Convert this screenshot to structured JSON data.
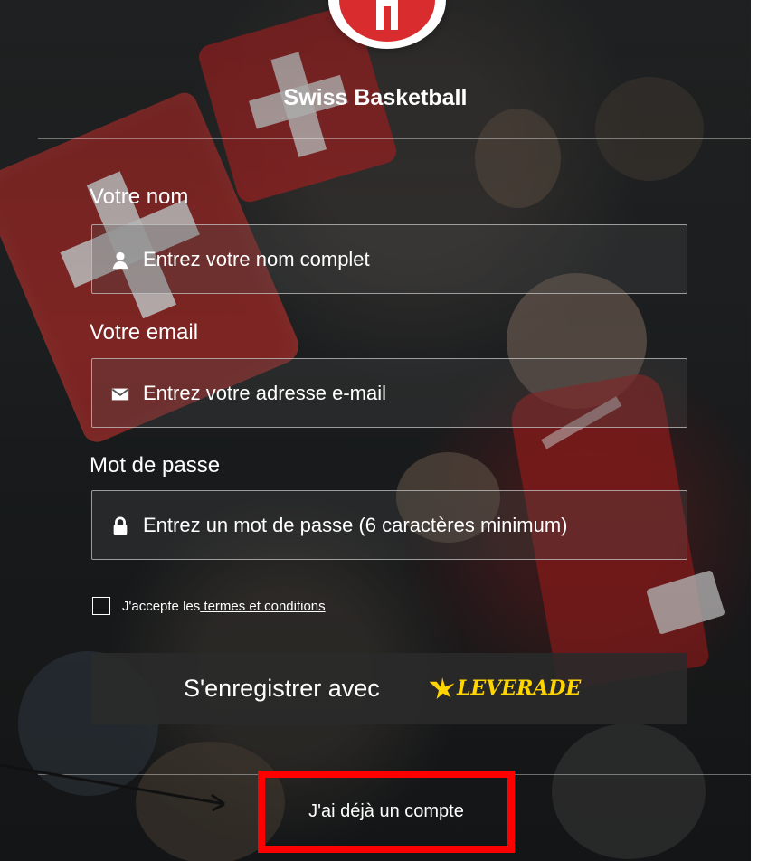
{
  "app": {
    "title": "Swiss Basketball"
  },
  "form": {
    "name": {
      "label": "Votre nom",
      "placeholder": "Entrez votre nom complet",
      "value": "",
      "icon": "user-icon"
    },
    "email": {
      "label": "Votre email",
      "placeholder": "Entrez votre adresse e-mail",
      "value": "",
      "icon": "envelope-icon"
    },
    "password": {
      "label": "Mot de passe",
      "placeholder": "Entrez un mot de passe (6 caractères minimum)",
      "value": "",
      "icon": "lock-icon"
    },
    "terms": {
      "prefix": "J'accepte les",
      "link": " termes et conditions",
      "checked": false
    },
    "submit": {
      "label": "S'enregistrer avec",
      "brand": "LEVERADE",
      "brand_color": "#ffd500"
    }
  },
  "footer": {
    "login_label": "J'ai déjà un compte",
    "highlight_color": "#ff0000"
  },
  "theme": {
    "accent": "#d92c2f",
    "text": "#ffffff"
  }
}
